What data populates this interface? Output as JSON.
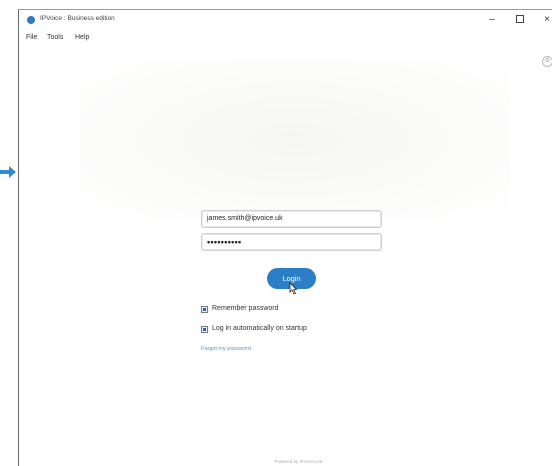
{
  "window": {
    "title": "IPVoice : Business edition",
    "minimize_glyph": "–",
    "close_glyph": "×",
    "accent_color": "#2a7fc6"
  },
  "menu": {
    "file": "File",
    "tools": "Tools",
    "help": "Help"
  },
  "login_form": {
    "email_value": "james.smith@ipvoice.uk",
    "password_value": "••••••••••",
    "login_label": "Login",
    "remember_password_label": "Remember password",
    "remember_password_checked": true,
    "auto_login_label": "Log in automatically on startup",
    "auto_login_checked": true,
    "forgot_password_link": "Forgot my password"
  },
  "footer": {
    "powered_by": "Powered by IPVoice Ltd."
  },
  "icons": {
    "pointer_arrow": "arrow-right-icon",
    "app": "ipvoice-app-icon",
    "side_control": "settings-circle-icon",
    "cursor": "mouse-cursor-icon"
  }
}
